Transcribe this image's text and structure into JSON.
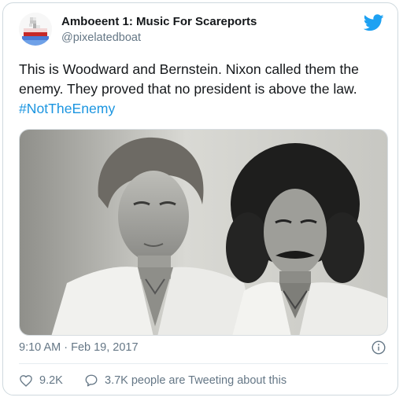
{
  "author": {
    "name": "Amboeent 1: Music For Scareports",
    "handle": "@pixelatedboat"
  },
  "tweet": {
    "text": "This is Woodward and Bernstein. Nixon called them the enemy. They proved that no president is above the law. ",
    "hashtag": "#NotTheEnemy",
    "timestamp": "9:10 AM · Feb 19, 2017"
  },
  "stats": {
    "likes": "9.2K",
    "conversation": "3.7K people are Tweeting about this"
  },
  "icons": {
    "brand": "twitter-bird-icon",
    "info": "info-icon",
    "like": "heart-icon",
    "reply": "speech-bubble-icon"
  },
  "colors": {
    "brand": "#1da1f2",
    "hashtag": "#1b95e0",
    "secondary_text": "#657786",
    "border": "#cfd9de"
  }
}
